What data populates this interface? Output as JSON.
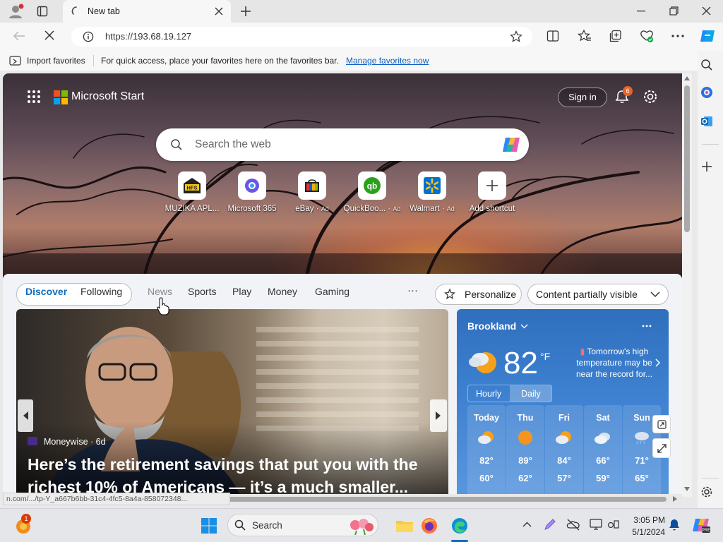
{
  "browser": {
    "tab_title": "New tab",
    "url": "https://193.68.19.127"
  },
  "favorites_bar": {
    "import_label": "Import favorites",
    "message": "For quick access, place your favorites here on the favorites bar.",
    "manage_link": "Manage favorites now"
  },
  "header": {
    "brand": "Microsoft Start",
    "sign_in": "Sign in",
    "notification_count": "6"
  },
  "search": {
    "placeholder": "Search the web"
  },
  "quick_links": [
    {
      "label": "MUZIKA APL...",
      "ad": "",
      "icon": "hfs-icon"
    },
    {
      "label": "Microsoft 365",
      "ad": "",
      "icon": "microsoft-365-icon"
    },
    {
      "label": "eBay",
      "ad": "Ad",
      "icon": "ebay-icon"
    },
    {
      "label": "QuickBoo...",
      "ad": "Ad",
      "icon": "quickbooks-icon"
    },
    {
      "label": "Walmart",
      "ad": "Ad",
      "icon": "walmart-icon"
    },
    {
      "label": "Add shortcut",
      "ad": "",
      "icon": "plus-icon"
    }
  ],
  "feed_nav": {
    "discover": "Discover",
    "following": "Following",
    "news": "News",
    "sports": "Sports",
    "play": "Play",
    "money": "Money",
    "gaming": "Gaming",
    "more": "···",
    "personalize": "Personalize",
    "content_visibility": "Content partially visible"
  },
  "main_story": {
    "source": "Moneywise · 6d",
    "headline_1": "Here’s the retirement savings that put you with the",
    "headline_2": "richest 10% of Americans — it’s a much smaller..."
  },
  "weather": {
    "location": "Brookland",
    "temperature": "82",
    "unit": "°F",
    "tip": "Tomorrow's high temperature may be near the record for...",
    "tab_hourly": "Hourly",
    "tab_daily": "Daily",
    "days": [
      {
        "day": "Today",
        "high": "82°",
        "low": "60°",
        "icon": "partly-sunny-icon"
      },
      {
        "day": "Thu",
        "high": "89°",
        "low": "62°",
        "icon": "sunny-icon"
      },
      {
        "day": "Fri",
        "high": "84°",
        "low": "57°",
        "icon": "partly-sunny-icon"
      },
      {
        "day": "Sat",
        "high": "66°",
        "low": "59°",
        "icon": "cloudy-icon"
      },
      {
        "day": "Sun",
        "high": "71°",
        "low": "65°",
        "icon": "rain-icon"
      }
    ]
  },
  "status_url": "n.com/.../tp-Y_a667b6bb-31c4-4fc5-8a4a-858072348...",
  "taskbar": {
    "search_label": "Search",
    "time": "3:05 PM",
    "date": "5/1/2024",
    "widget_badge": "1"
  },
  "colors": {
    "accent": "#0f6cbd",
    "weather_bg": "#3c7fcf",
    "notification_badge": "#e8652a"
  }
}
